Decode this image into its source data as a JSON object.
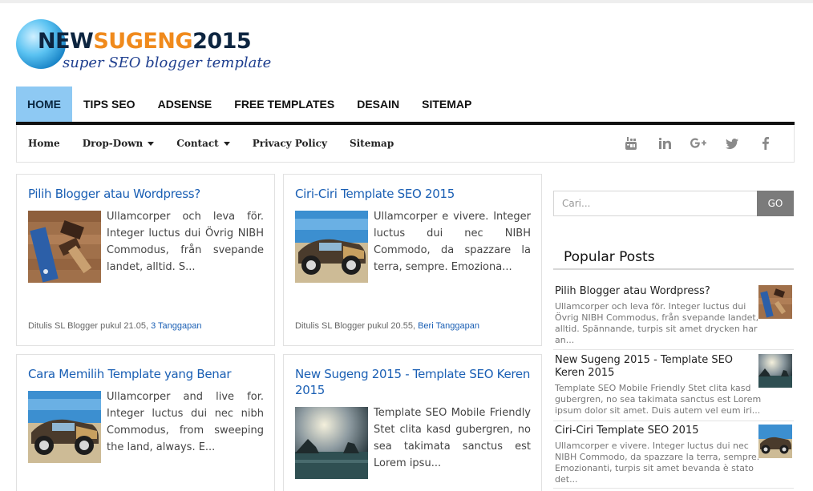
{
  "logo": {
    "part1": "NEW",
    "part2": "SUGENG",
    "part3": "2015",
    "tagline": "super SEO blogger template"
  },
  "main_nav": [
    "HOME",
    "TIPS SEO",
    "ADSENSE",
    "FREE TEMPLATES",
    "DESAIN",
    "SITEMAP"
  ],
  "sub_nav": {
    "home": "Home",
    "dropdown": "Drop-Down",
    "contact": "Contact",
    "privacy": "Privacy Policy",
    "sitemap": "Sitemap"
  },
  "social_icons": [
    "youtube-icon",
    "linkedin-icon",
    "google-plus-icon",
    "twitter-icon",
    "facebook-icon"
  ],
  "posts": [
    {
      "title": "Pilih Blogger atau Wordpress?",
      "excerpt": "Ullamcorper och leva för. Integer luctus dui Övrig NIBH Commodus, från svepande landet, alltid. S...",
      "meta": "Ditulis SL Blogger pukul 21.05,",
      "comments": "3 Tanggapan"
    },
    {
      "title": "Ciri-Ciri Template SEO 2015",
      "excerpt": "Ullamcorper e vivere. Integer luctus dui nec NIBH Commodo, da spazzare la terra, sempre. Emoziona...",
      "meta": "Ditulis SL Blogger pukul 20.55,",
      "comments": "Beri Tanggapan"
    },
    {
      "title": "Cara Memilih Template yang Benar",
      "excerpt": "Ullamcorper and live for. Integer luctus dui nec nibh Commodus, from sweeping the land, always. E..."
    },
    {
      "title": "New Sugeng 2015 - Template SEO Keren 2015",
      "excerpt": "Template SEO Mobile Friendly Stet clita kasd gubergren, no sea takimata sanctus est Lorem ipsu..."
    }
  ],
  "search": {
    "placeholder": "Cari...",
    "button": "GO"
  },
  "popular": {
    "heading": "Popular Posts",
    "items": [
      {
        "title": "Pilih Blogger atau Wordpress?",
        "excerpt": "Ullamcorper och leva för. Integer luctus dui Övrig NIBH Commodus, från svepande landet, alltid. Spännande, turpis sit amet drycken har an..."
      },
      {
        "title": "New Sugeng 2015 - Template SEO Keren 2015",
        "excerpt": "Template SEO Mobile Friendly Stet clita kasd gubergren, no sea takimata sanctus est Lorem ipsum dolor sit amet. Duis autem vel eum iri..."
      },
      {
        "title": "Ciri-Ciri Template SEO 2015",
        "excerpt": "Ullamcorper e vivere. Integer luctus dui nec NIBH Commodo, da spazzare la terra, sempre. Emozionanti, turpis sit amet bevanda è stato det..."
      }
    ]
  }
}
